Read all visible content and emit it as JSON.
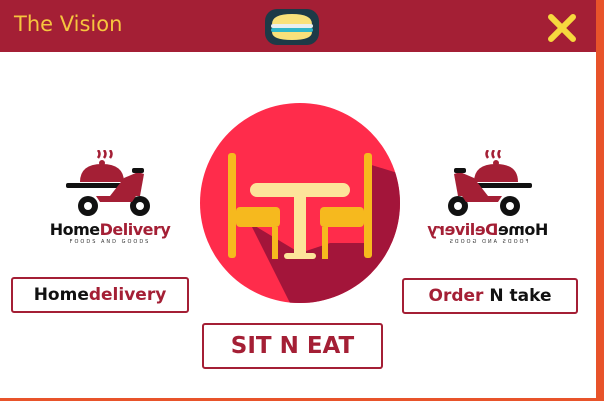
{
  "window": {
    "title": "The Vision",
    "close_icon": "close-x-icon",
    "header_icon": "burger-icon"
  },
  "logos": {
    "left": {
      "brand_part1": "Home",
      "brand_part2": "Delivery",
      "tagline": "FOODS AND GOODS",
      "icon": "scooter-delivery-icon"
    },
    "right": {
      "brand_part1": "Home",
      "brand_part2": "Delivery",
      "tagline": "FOODS AND GOODS",
      "icon": "scooter-delivery-icon"
    }
  },
  "hero": {
    "icon": "table-chairs-icon"
  },
  "buttons": {
    "home_delivery": {
      "part1": "Home",
      "part2": "delivery"
    },
    "order_n_take": {
      "part1": "Order",
      "part2": "N take"
    },
    "sit_n_eat": "SIT N EAT"
  },
  "colors": {
    "titlebar": "#a41f35",
    "title_text": "#f6c53e",
    "accent_red": "#a41f35",
    "hero_circle": "#ff2c4b",
    "right_edge": "#e8532a"
  }
}
